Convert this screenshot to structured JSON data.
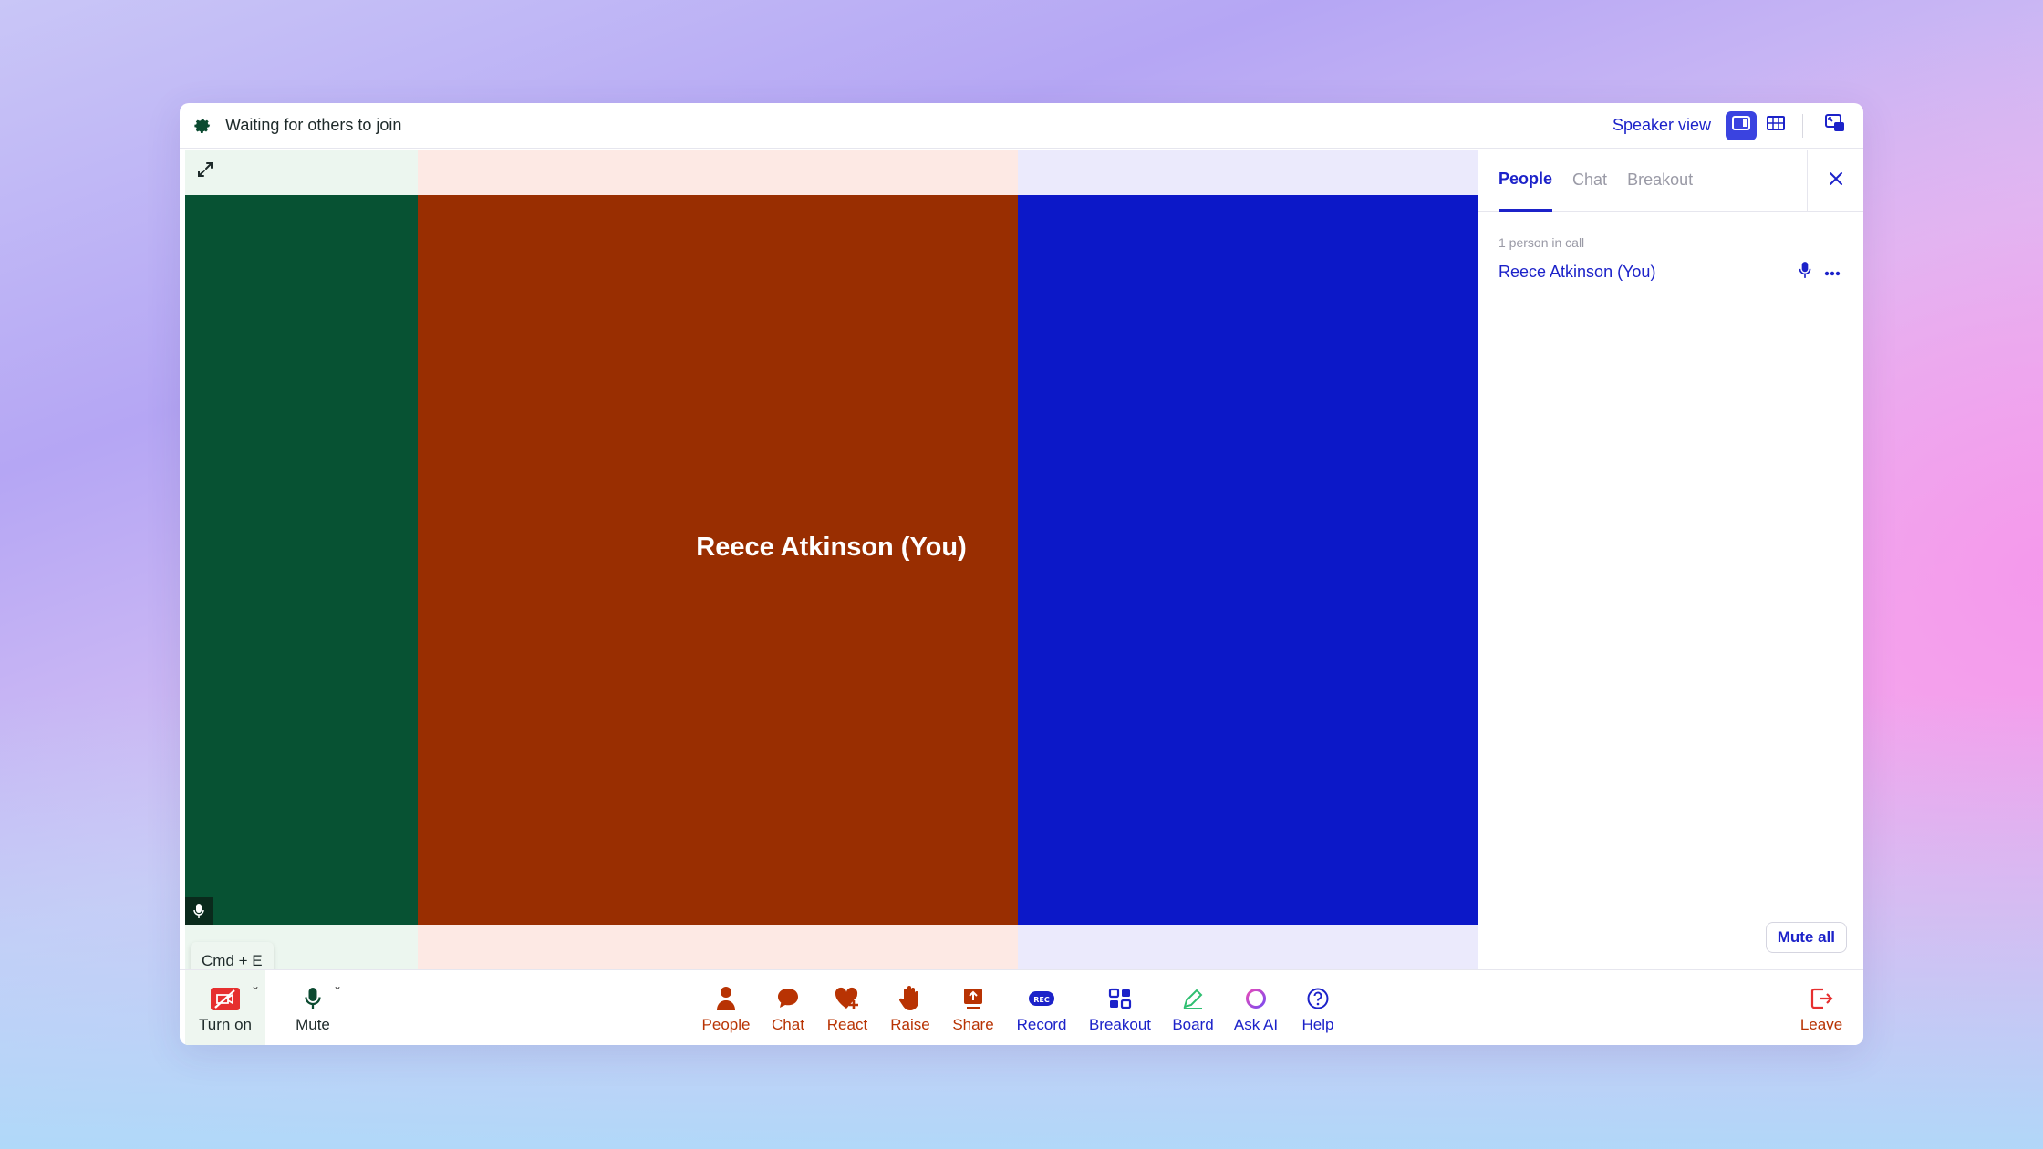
{
  "topbar": {
    "status": "Waiting for others to join",
    "view_label": "Speaker view"
  },
  "stage": {
    "participant_name": "Reece Atkinson (You)",
    "shortcut_tooltip": "Cmd + E"
  },
  "panel": {
    "tabs": [
      {
        "label": "People"
      },
      {
        "label": "Chat"
      },
      {
        "label": "Breakout"
      }
    ],
    "count_text": "1 person in call",
    "people": [
      {
        "name": "Reece Atkinson (You)"
      }
    ],
    "mute_all_label": "Mute all"
  },
  "controls": {
    "camera": "Turn on",
    "mute": "Mute",
    "center": [
      {
        "label": "People",
        "icon": "person-icon"
      },
      {
        "label": "Chat",
        "icon": "chat-bubble-icon"
      },
      {
        "label": "React",
        "icon": "heart-plus-icon"
      },
      {
        "label": "Raise",
        "icon": "raise-hand-icon"
      },
      {
        "label": "Share",
        "icon": "share-screen-icon"
      },
      {
        "label": "Record",
        "icon": "rec-icon"
      },
      {
        "label": "Breakout",
        "icon": "breakout-grid-icon"
      },
      {
        "label": "Board",
        "icon": "pencil-board-icon"
      },
      {
        "label": "Ask AI",
        "icon": "ai-ring-icon"
      },
      {
        "label": "Help",
        "icon": "help-icon"
      }
    ],
    "leave": "Leave",
    "rec_badge": "REC"
  },
  "colors": {
    "accent": "#1c22c9",
    "tile_green": "#075233",
    "tile_orange": "#992e01",
    "tile_blue": "#0c18c8",
    "control_red": "#b83303"
  }
}
